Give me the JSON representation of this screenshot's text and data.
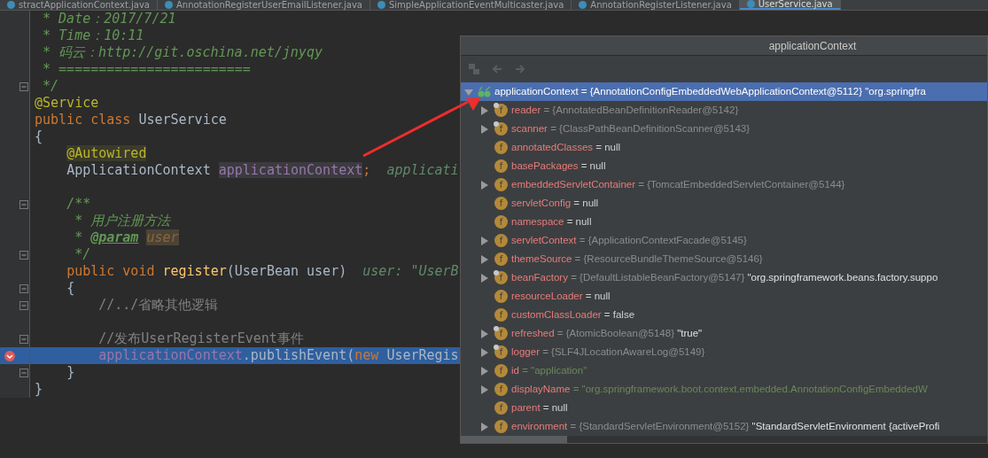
{
  "tabs": [
    {
      "label": "stractApplicationContext.java",
      "selected": false
    },
    {
      "label": "AnnotationRegisterUserEmailListener.java",
      "selected": false
    },
    {
      "label": "SimpleApplicationEventMulticaster.java",
      "selected": false
    },
    {
      "label": "AnnotationRegisterListener.java",
      "selected": false
    },
    {
      "label": "UserService.java",
      "selected": true
    }
  ],
  "editor": {
    "lines": [
      {
        "fold": false,
        "breakpoint": false,
        "selected": false,
        "segments": [
          {
            "kind": "doc",
            "text": " * Date：2017/7/21"
          }
        ]
      },
      {
        "fold": false,
        "breakpoint": false,
        "selected": false,
        "segments": [
          {
            "kind": "doc",
            "text": " * Time：10:11"
          }
        ]
      },
      {
        "fold": false,
        "breakpoint": false,
        "selected": false,
        "segments": [
          {
            "kind": "doc",
            "text": " * 码云：http://git.oschina.net/jnyqy"
          }
        ]
      },
      {
        "fold": false,
        "breakpoint": false,
        "selected": false,
        "segments": [
          {
            "kind": "doc",
            "text": " * ========================"
          }
        ]
      },
      {
        "fold": true,
        "breakpoint": false,
        "selected": false,
        "segments": [
          {
            "kind": "doc",
            "text": " */"
          }
        ]
      },
      {
        "fold": false,
        "breakpoint": false,
        "selected": false,
        "segments": [
          {
            "kind": "annot",
            "text": "@Service"
          }
        ]
      },
      {
        "fold": false,
        "breakpoint": false,
        "selected": false,
        "segments": [
          {
            "kind": "kw",
            "text": "public class "
          },
          {
            "kind": "plain",
            "text": "UserService"
          }
        ]
      },
      {
        "fold": false,
        "breakpoint": false,
        "selected": false,
        "segments": [
          {
            "kind": "plain",
            "text": "{"
          }
        ]
      },
      {
        "fold": false,
        "breakpoint": false,
        "selected": false,
        "segments": [
          {
            "kind": "annotmark",
            "text": "    @Autowired"
          }
        ]
      },
      {
        "fold": false,
        "breakpoint": false,
        "selected": false,
        "segments": [
          {
            "kind": "plain",
            "text": "    ApplicationContext "
          },
          {
            "kind": "fieldmark",
            "text": "applicationContext"
          },
          {
            "kind": "kw",
            "text": ";"
          },
          {
            "kind": "hint",
            "text": "  applicati"
          }
        ]
      },
      {
        "fold": false,
        "breakpoint": false,
        "selected": false
      },
      {
        "fold": true,
        "breakpoint": false,
        "selected": false,
        "segments": [
          {
            "kind": "doc",
            "text": "    /**"
          }
        ]
      },
      {
        "fold": false,
        "breakpoint": false,
        "selected": false,
        "segments": [
          {
            "kind": "doc",
            "text": "     * 用户注册方法"
          }
        ]
      },
      {
        "fold": false,
        "breakpoint": false,
        "selected": false,
        "segments": [
          {
            "kind": "doc",
            "text": "     * "
          },
          {
            "kind": "doctag",
            "text": "@param"
          },
          {
            "kind": "docparam",
            "text": " user"
          }
        ]
      },
      {
        "fold": true,
        "breakpoint": false,
        "selected": false,
        "segments": [
          {
            "kind": "doc",
            "text": "     */"
          }
        ]
      },
      {
        "fold": false,
        "breakpoint": false,
        "selected": false,
        "segments": [
          {
            "kind": "kw",
            "text": "    public void "
          },
          {
            "kind": "method",
            "text": "register"
          },
          {
            "kind": "plain",
            "text": "(UserBean user)"
          },
          {
            "kind": "hint",
            "text": "  user: \"UserB"
          }
        ]
      },
      {
        "fold": true,
        "breakpoint": false,
        "selected": false,
        "segments": [
          {
            "kind": "plain",
            "text": "    {"
          }
        ]
      },
      {
        "fold": true,
        "breakpoint": false,
        "selected": false,
        "segments": [
          {
            "kind": "comment",
            "text": "        //../省略其他逻辑"
          }
        ]
      },
      {
        "fold": false,
        "breakpoint": false,
        "selected": false
      },
      {
        "fold": true,
        "breakpoint": false,
        "selected": false,
        "segments": [
          {
            "kind": "comment",
            "text": "        //发布UserRegisterEvent事件"
          }
        ]
      },
      {
        "fold": false,
        "breakpoint": true,
        "selected": true,
        "segments": [
          {
            "kind": "field",
            "text": "        applicationContext"
          },
          {
            "kind": "plain",
            "text": ".publishEvent("
          },
          {
            "kind": "kw",
            "text": "new "
          },
          {
            "kind": "plain",
            "text": "UserRegis"
          }
        ]
      },
      {
        "fold": true,
        "breakpoint": false,
        "selected": false,
        "segments": [
          {
            "kind": "plain",
            "text": "    }"
          }
        ]
      },
      {
        "fold": false,
        "breakpoint": false,
        "selected": false,
        "segments": [
          {
            "kind": "plain",
            "text": "}"
          }
        ]
      }
    ]
  },
  "popup": {
    "title": "applicationContext",
    "tree": {
      "name": "applicationContext",
      "value": "= {AnnotationConfigEmbeddedWebApplicationContext@5112}",
      "extra": "\"org.springfra",
      "expanded": true,
      "selected": true,
      "children": [
        {
          "badge": "f",
          "name": "reader",
          "kind": "ref",
          "value": "= {AnnotatedBeanDefinitionReader@5142}",
          "expandable": true,
          "final": true
        },
        {
          "badge": "f",
          "name": "scanner",
          "kind": "ref",
          "value": "= {ClassPathBeanDefinitionScanner@5143}",
          "expandable": true,
          "final": true
        },
        {
          "badge": "f",
          "name": "annotatedClasses",
          "kind": "literal",
          "value": "= null",
          "expandable": false,
          "final": false
        },
        {
          "badge": "f",
          "name": "basePackages",
          "kind": "literal",
          "value": "= null",
          "expandable": false,
          "final": false
        },
        {
          "badge": "f",
          "name": "embeddedServletContainer",
          "kind": "ref",
          "value": "= {TomcatEmbeddedServletContainer@5144}",
          "expandable": true,
          "final": false
        },
        {
          "badge": "f",
          "name": "servletConfig",
          "kind": "literal",
          "value": "= null",
          "expandable": false,
          "final": false
        },
        {
          "badge": "f",
          "name": "namespace",
          "kind": "literal",
          "value": "= null",
          "expandable": false,
          "final": false
        },
        {
          "badge": "f",
          "name": "servletContext",
          "kind": "ref",
          "value": "= {ApplicationContextFacade@5145}",
          "expandable": true,
          "final": false
        },
        {
          "badge": "f",
          "name": "themeSource",
          "kind": "ref",
          "value": "= {ResourceBundleThemeSource@5146}",
          "expandable": true,
          "final": false
        },
        {
          "badge": "f",
          "name": "beanFactory",
          "kind": "ref",
          "value": "= {DefaultListableBeanFactory@5147}",
          "extra": "\"org.springframework.beans.factory.suppo",
          "expandable": true,
          "final": true
        },
        {
          "badge": "f",
          "name": "resourceLoader",
          "kind": "literal",
          "value": "= null",
          "expandable": false,
          "final": false
        },
        {
          "badge": "f",
          "name": "customClassLoader",
          "kind": "literal",
          "value": "= false",
          "expandable": false,
          "final": false
        },
        {
          "badge": "f",
          "name": "refreshed",
          "kind": "ref",
          "value": "= {AtomicBoolean@5148}",
          "extra": "\"true\"",
          "expandable": true,
          "final": true
        },
        {
          "badge": "f",
          "name": "logger",
          "kind": "ref",
          "value": "= {SLF4JLocationAwareLog@5149}",
          "expandable": true,
          "final": true
        },
        {
          "badge": "f",
          "name": "id",
          "kind": "string",
          "value": "= \"application\"",
          "expandable": true,
          "final": false
        },
        {
          "badge": "f",
          "name": "displayName",
          "kind": "string",
          "value": "= \"org.springframework.boot.context.embedded.AnnotationConfigEmbeddedW",
          "expandable": true,
          "final": false
        },
        {
          "badge": "f",
          "name": "parent",
          "kind": "literal",
          "value": "= null",
          "expandable": false,
          "final": false
        },
        {
          "badge": "f",
          "name": "environment",
          "kind": "ref",
          "value": "= {StandardServletEnvironment@5152}",
          "extra": "\"StandardServletEnvironment {activeProfi",
          "expandable": true,
          "final": false
        }
      ]
    }
  }
}
